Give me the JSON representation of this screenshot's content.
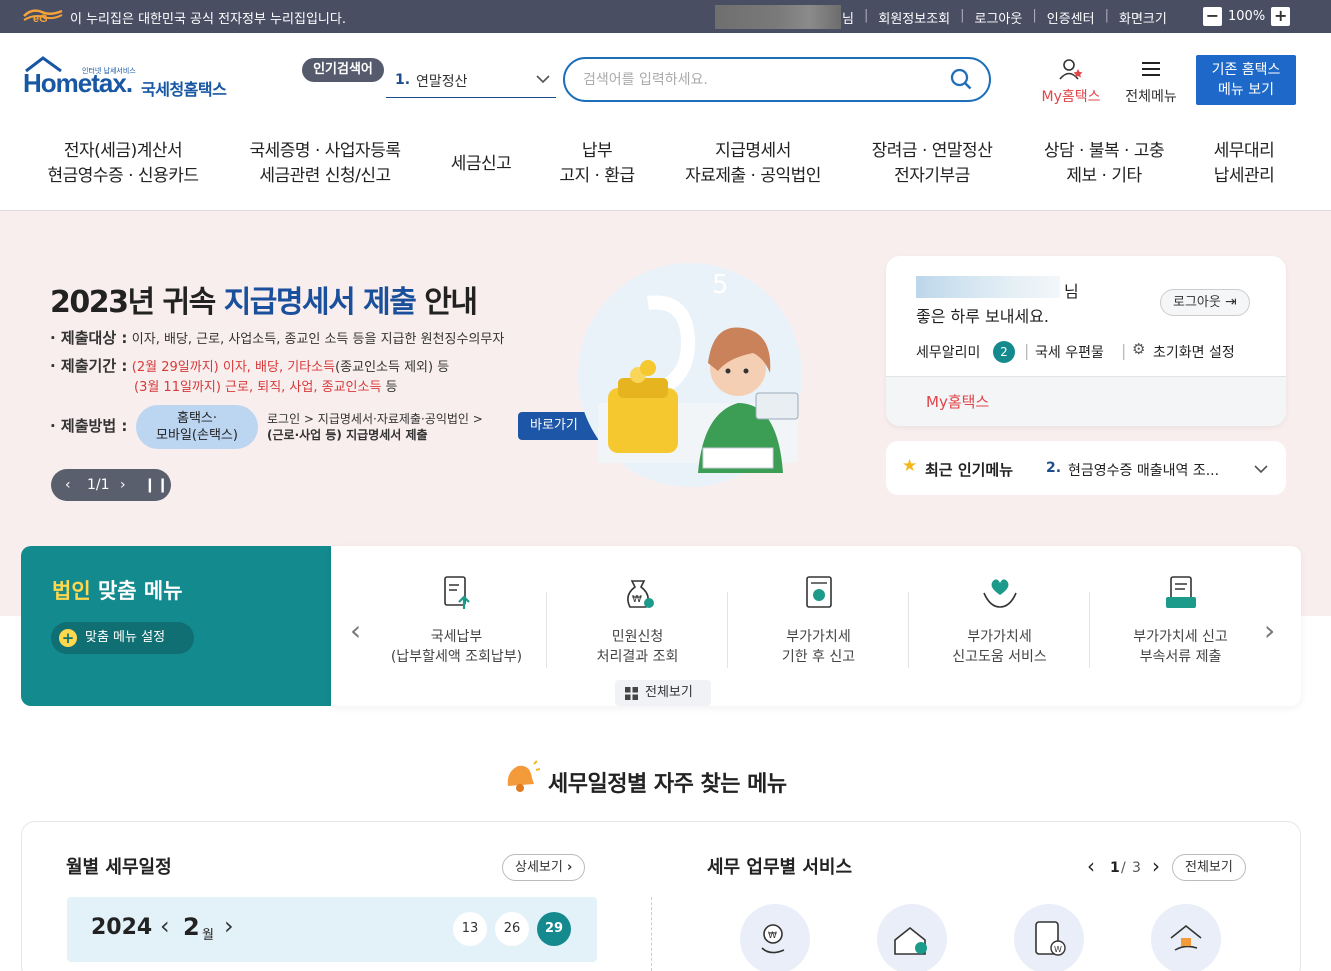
{
  "topbar": {
    "notice": "이 누리집은 대한민국 공식 전자정부 누리집입니다.",
    "user_suffix": "님",
    "links": [
      "회원정보조회",
      "로그아웃",
      "인증센터",
      "화면크기"
    ],
    "zoom_minus": "−",
    "zoom": "100%",
    "zoom_plus": "+"
  },
  "header": {
    "logo_main": "Hometax.",
    "logo_sub": "인터넷 납세서비스",
    "logo_kor": "국세청홈택스",
    "popular_badge": "인기검색어",
    "popular_num": "1.",
    "popular_term": "연말정산",
    "search_placeholder": "검색어를 입력하세요.",
    "myhometax": "My홈택스",
    "allmenu": "전체메뉴",
    "old_menu_line1": "기존 홈택스",
    "old_menu_line2": "메뉴 보기"
  },
  "gnb": [
    {
      "l1": "전자(세금)계산서",
      "l2": "현금영수증 · 신용카드"
    },
    {
      "l1": "국세증명 · 사업자등록",
      "l2": "세금관련 신청/신고"
    },
    {
      "l1": "세금신고",
      "l2": ""
    },
    {
      "l1": "납부",
      "l2": "고지 · 환급"
    },
    {
      "l1": "지급명세서",
      "l2": "자료제출 · 공익법인"
    },
    {
      "l1": "장려금 · 연말정산",
      "l2": "전자기부금"
    },
    {
      "l1": "상담 · 불복 · 고충",
      "l2": "제보 · 기타"
    },
    {
      "l1": "세무대리",
      "l2": "납세관리"
    }
  ],
  "banner": {
    "title_a": "2023년 귀속 ",
    "title_b": "지급명세서 제출",
    "title_c": " 안내",
    "target_label": "· 제출대상 :",
    "target_text": "이자, 배당, 근로, 사업소득, 종교인 소득 등을 지급한 원천징수의무자",
    "period_label": "· 제출기간 :",
    "period1_red": "(2월 29일까지) 이자, 배당, 기타소득",
    "period1_rest": "(종교인소득 제외) 등",
    "period2_red": "(3월 11일까지) 근로, 퇴직, 사업, 종교인소득",
    "period2_rest": " 등",
    "method_label": "· 제출방법 :",
    "chip_line1": "홈택스·",
    "chip_line2": "모바일(손택스)",
    "desc_line1": "로그인 > 지급명세서·자료제출·공익법인 >",
    "desc_line2": "(근로·사업 등) 지급명세서 제출",
    "go_button": "바로가기",
    "pager": "1/1"
  },
  "login_card": {
    "user_suffix": "님",
    "greeting": "좋은 하루 보내세요.",
    "logout": "로그아웃",
    "alarm": "세무알리미",
    "alarm_count": "2",
    "mall": "국세 우편물",
    "settings": "초기화면 설정",
    "myhometax": "My홈택스"
  },
  "popular_menu": {
    "label": "최근 인기메뉴",
    "num": "2.",
    "text": "현금영수증 매출내역 조..."
  },
  "corp_menu": {
    "title_y": "법인",
    "title_rest": " 맞춤 메뉴",
    "setting_button": "맞춤 메뉴 설정",
    "items": [
      {
        "l1": "국세납부",
        "l2": "(납부할세액 조회납부)"
      },
      {
        "l1": "민원신청",
        "l2": "처리결과 조회"
      },
      {
        "l1": "부가가치세",
        "l2": "기한 후 신고"
      },
      {
        "l1": "부가가치세",
        "l2": "신고도움 서비스"
      },
      {
        "l1": "부가가치세 신고",
        "l2": "부속서류 제출"
      }
    ],
    "view_all": "전체보기"
  },
  "schedule_section": {
    "title": "세무일정별 자주 찾는 메뉴",
    "monthly_title": "월별 세무일정",
    "detail_button": "상세보기",
    "year": "2024",
    "month": "2",
    "month_unit": "월",
    "days": [
      "13",
      "26",
      "29"
    ],
    "service_title": "세무 업무별 서비스",
    "service_page_cur": "1",
    "service_page_sep": "/",
    "service_page_total": "3",
    "service_view_all": "전체보기"
  }
}
